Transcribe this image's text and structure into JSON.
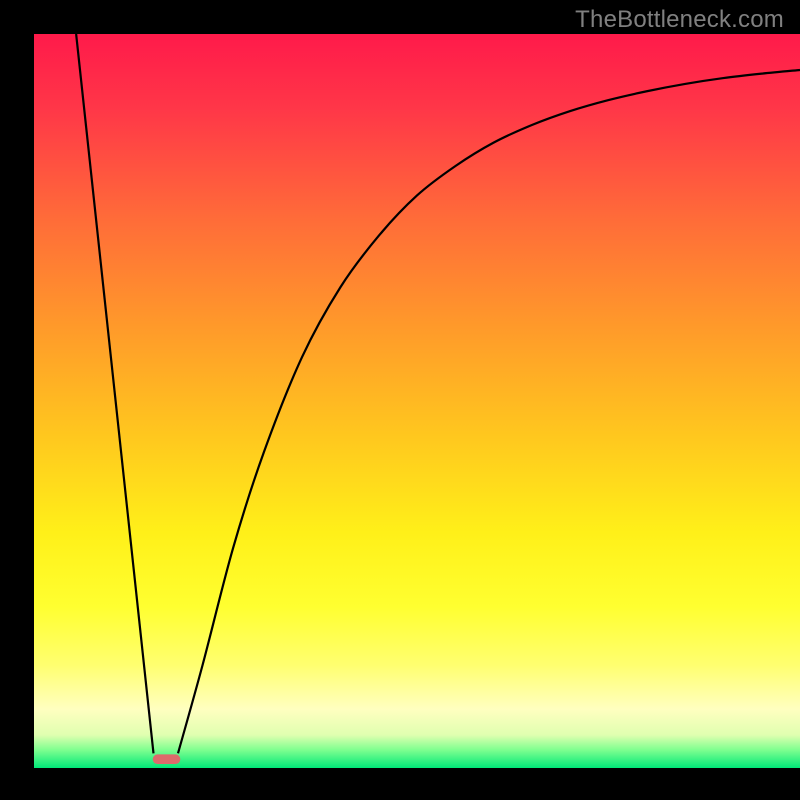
{
  "watermark": "TheBottleneck.com",
  "chart_data": {
    "type": "line",
    "title": "",
    "xlabel": "",
    "ylabel": "",
    "xlim": [
      0,
      100
    ],
    "ylim": [
      0,
      100
    ],
    "grid": false,
    "legend": false,
    "background_gradient": {
      "stops": [
        {
          "offset": 0.0,
          "color": "#ff1a4a"
        },
        {
          "offset": 0.1,
          "color": "#ff3648"
        },
        {
          "offset": 0.25,
          "color": "#ff6b39"
        },
        {
          "offset": 0.4,
          "color": "#ff9a2a"
        },
        {
          "offset": 0.55,
          "color": "#ffc81e"
        },
        {
          "offset": 0.68,
          "color": "#fff019"
        },
        {
          "offset": 0.78,
          "color": "#ffff30"
        },
        {
          "offset": 0.86,
          "color": "#ffff70"
        },
        {
          "offset": 0.92,
          "color": "#ffffc0"
        },
        {
          "offset": 0.955,
          "color": "#e0ffb0"
        },
        {
          "offset": 0.975,
          "color": "#80ff90"
        },
        {
          "offset": 1.0,
          "color": "#00e878"
        }
      ]
    },
    "series": [
      {
        "name": "left-branch",
        "x": [
          5.5,
          15.6
        ],
        "y": [
          100,
          2
        ]
      },
      {
        "name": "right-branch",
        "x": [
          18.8,
          22,
          26,
          30,
          35,
          40,
          45,
          50,
          55,
          60,
          65,
          70,
          75,
          80,
          85,
          90,
          95,
          100
        ],
        "y": [
          2,
          14,
          30,
          43,
          56,
          65.5,
          72.5,
          78,
          82,
          85.2,
          87.6,
          89.5,
          91,
          92.2,
          93.2,
          94,
          94.6,
          95.1
        ]
      }
    ],
    "marker": {
      "name": "minimum-marker",
      "x": 17.3,
      "y": 1.2,
      "width": 3.6,
      "height": 1.3,
      "color": "#dd6b6b"
    }
  }
}
